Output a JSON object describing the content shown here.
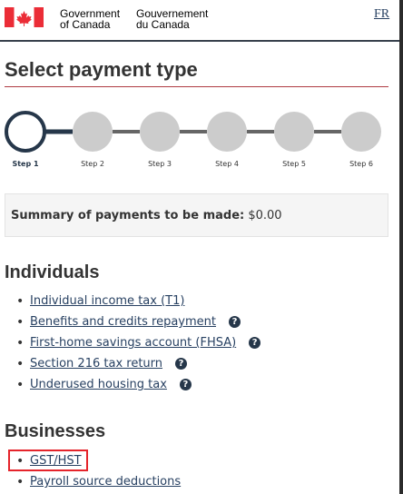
{
  "header": {
    "gov_en_line1": "Government",
    "gov_en_line2": "of Canada",
    "gov_fr_line1": "Gouvernement",
    "gov_fr_line2": "du Canada",
    "lang_toggle": "FR"
  },
  "page_title": "Select payment type",
  "steps": [
    "Step 1",
    "Step 2",
    "Step 3",
    "Step 4",
    "Step 5",
    "Step 6"
  ],
  "current_step": 1,
  "summary": {
    "label": "Summary of payments to be made:",
    "amount": "$0.00"
  },
  "individuals": {
    "heading": "Individuals",
    "items": [
      {
        "label": "Individual income tax (T1)",
        "help": false
      },
      {
        "label": "Benefits and credits repayment",
        "help": true
      },
      {
        "label": "First-home savings account (FHSA)",
        "help": true
      },
      {
        "label": "Section 216 tax return",
        "help": true
      },
      {
        "label": "Underused housing tax",
        "help": true
      }
    ]
  },
  "businesses": {
    "heading": "Businesses",
    "items": [
      {
        "label": "GST/HST",
        "help": false
      },
      {
        "label": "Payroll source deductions",
        "help": false
      }
    ]
  },
  "colors": {
    "link": "#284162",
    "accent": "#af3c43",
    "step_active": "#26374a",
    "step_inactive": "#cccccc",
    "highlight": "#e5242b"
  }
}
